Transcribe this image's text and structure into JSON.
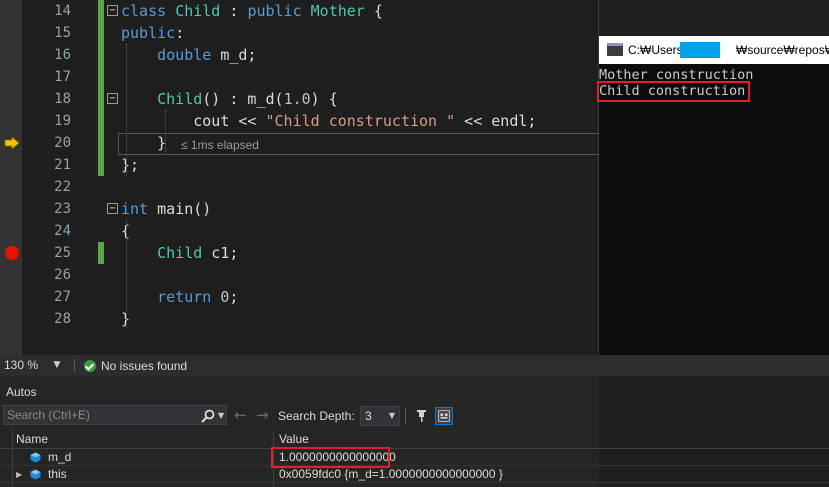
{
  "editor": {
    "lines": [
      {
        "num": "14",
        "html_tokens": [
          [
            "kw",
            "class"
          ],
          [
            "pl",
            " "
          ],
          [
            "ty",
            "Child"
          ],
          [
            "pl",
            " : "
          ],
          [
            "kw",
            "public"
          ],
          [
            "pl",
            " "
          ],
          [
            "ty",
            "Mother"
          ],
          [
            "pl",
            " {"
          ]
        ]
      },
      {
        "num": "15",
        "html_tokens": [
          [
            "kw",
            "public"
          ],
          [
            "pl",
            ":"
          ]
        ]
      },
      {
        "num": "16",
        "html_tokens": [
          [
            "pl",
            "    "
          ],
          [
            "kw",
            "double"
          ],
          [
            "pl",
            " m_d;"
          ]
        ]
      },
      {
        "num": "17",
        "html_tokens": []
      },
      {
        "num": "18",
        "html_tokens": [
          [
            "pl",
            "    "
          ],
          [
            "ty",
            "Child"
          ],
          [
            "pl",
            "() : m_d("
          ],
          [
            "num",
            "1.0"
          ],
          [
            "pl",
            ") {"
          ]
        ]
      },
      {
        "num": "19",
        "html_tokens": [
          [
            "pl",
            "        cout << "
          ],
          [
            "str",
            "\"Child construction \""
          ],
          [
            "pl",
            " << endl;"
          ]
        ]
      },
      {
        "num": "20",
        "html_tokens": [
          [
            "pl",
            "    }"
          ]
        ]
      },
      {
        "num": "21",
        "html_tokens": [
          [
            "pl",
            "};"
          ]
        ]
      },
      {
        "num": "22",
        "html_tokens": []
      },
      {
        "num": "23",
        "html_tokens": [
          [
            "kw",
            "int"
          ],
          [
            "pl",
            " main()"
          ]
        ]
      },
      {
        "num": "24",
        "html_tokens": [
          [
            "pl",
            "{"
          ]
        ]
      },
      {
        "num": "25",
        "html_tokens": [
          [
            "pl",
            "    "
          ],
          [
            "ty",
            "Child"
          ],
          [
            "pl",
            " c1;"
          ]
        ]
      },
      {
        "num": "26",
        "html_tokens": []
      },
      {
        "num": "27",
        "html_tokens": [
          [
            "pl",
            "    "
          ],
          [
            "kw",
            "return"
          ],
          [
            "pl",
            " "
          ],
          [
            "num",
            "0"
          ],
          [
            "pl",
            ";"
          ]
        ]
      },
      {
        "num": "28",
        "html_tokens": [
          [
            "pl",
            "}"
          ]
        ]
      }
    ],
    "elapsed": "≤ 1ms elapsed"
  },
  "console": {
    "title": "C:\\Users\\          \\source\\repos\\MyP",
    "title_parts": [
      "C:₩Users₩",
      "₩source₩repos₩MyP"
    ],
    "output": [
      "Mother construction",
      "Child construction"
    ]
  },
  "status": {
    "zoom": "130 %",
    "issues": "No issues found"
  },
  "autos": {
    "title": "Autos",
    "search_placeholder": "Search (Ctrl+E)",
    "search_depth_label": "Search Depth:",
    "search_depth_value": "3",
    "columns": {
      "name": "Name",
      "value": "Value"
    },
    "rows": [
      {
        "name": "m_d",
        "value": "1.0000000000000000",
        "expandable": false
      },
      {
        "name": "this",
        "value": "0x0059fdc0 {m_d=1.0000000000000000 }",
        "expandable": true
      }
    ]
  },
  "colors": {
    "highlight_box": "#e0202a",
    "redaction": "#00a2e8",
    "breakpoint": "#e51400",
    "change_bar": "#57a64a"
  }
}
